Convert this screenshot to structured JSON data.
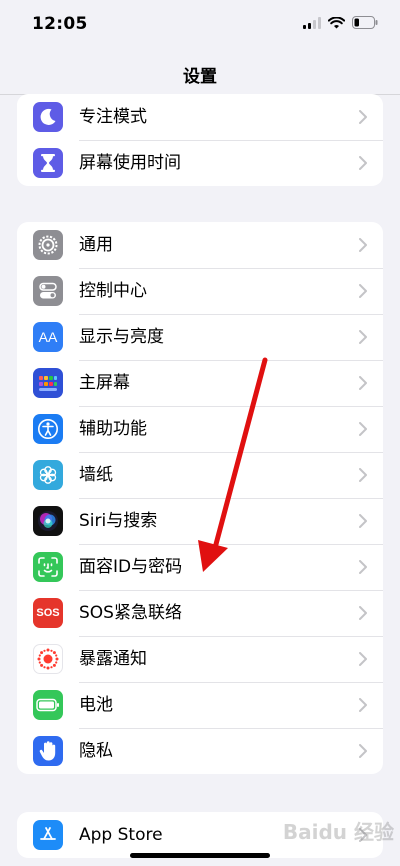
{
  "status_bar": {
    "time": "12:05",
    "battery_level_percent": 25
  },
  "header": {
    "title": "设置"
  },
  "groups": [
    {
      "items": [
        {
          "label": "专注模式",
          "icon": "moon-icon",
          "color": "#5e5ce6"
        },
        {
          "label": "屏幕使用时间",
          "icon": "hourglass-icon",
          "color": "#5e5ce6"
        }
      ]
    },
    {
      "items": [
        {
          "label": "通用",
          "icon": "gear-icon",
          "color": "#8e8e93"
        },
        {
          "label": "控制中心",
          "icon": "toggles-icon",
          "color": "#8e8e93"
        },
        {
          "label": "显示与亮度",
          "icon": "text-size-icon",
          "icon_text": "AA",
          "color": "#2f7ef6"
        },
        {
          "label": "主屏幕",
          "icon": "home-grid-icon",
          "color": "#2f50d6"
        },
        {
          "label": "辅助功能",
          "icon": "accessibility-icon",
          "color": "#1b7cf3"
        },
        {
          "label": "墙纸",
          "icon": "wallpaper-flower-icon",
          "color": "#33a9dd"
        },
        {
          "label": "Siri与搜索",
          "icon": "siri-icon",
          "color": "#111111"
        },
        {
          "label": "面容ID与密码",
          "icon": "face-id-icon",
          "color": "#34c759"
        },
        {
          "label": "SOS紧急联络",
          "icon": "sos-icon",
          "icon_text": "SOS",
          "color": "#e5352b"
        },
        {
          "label": "暴露通知",
          "icon": "exposure-icon",
          "color": "#ffffff"
        },
        {
          "label": "电池",
          "icon": "battery-icon",
          "color": "#34c759"
        },
        {
          "label": "隐私",
          "icon": "hand-icon",
          "color": "#2f6bf0"
        }
      ]
    },
    {
      "items": [
        {
          "label": "App Store",
          "icon": "app-store-icon",
          "color": "#1d8cf8"
        }
      ]
    }
  ],
  "watermark": "Baidu 经验",
  "annotation": {
    "color": "#e01010",
    "description": "red arrow pointing to 面容ID与密码"
  }
}
